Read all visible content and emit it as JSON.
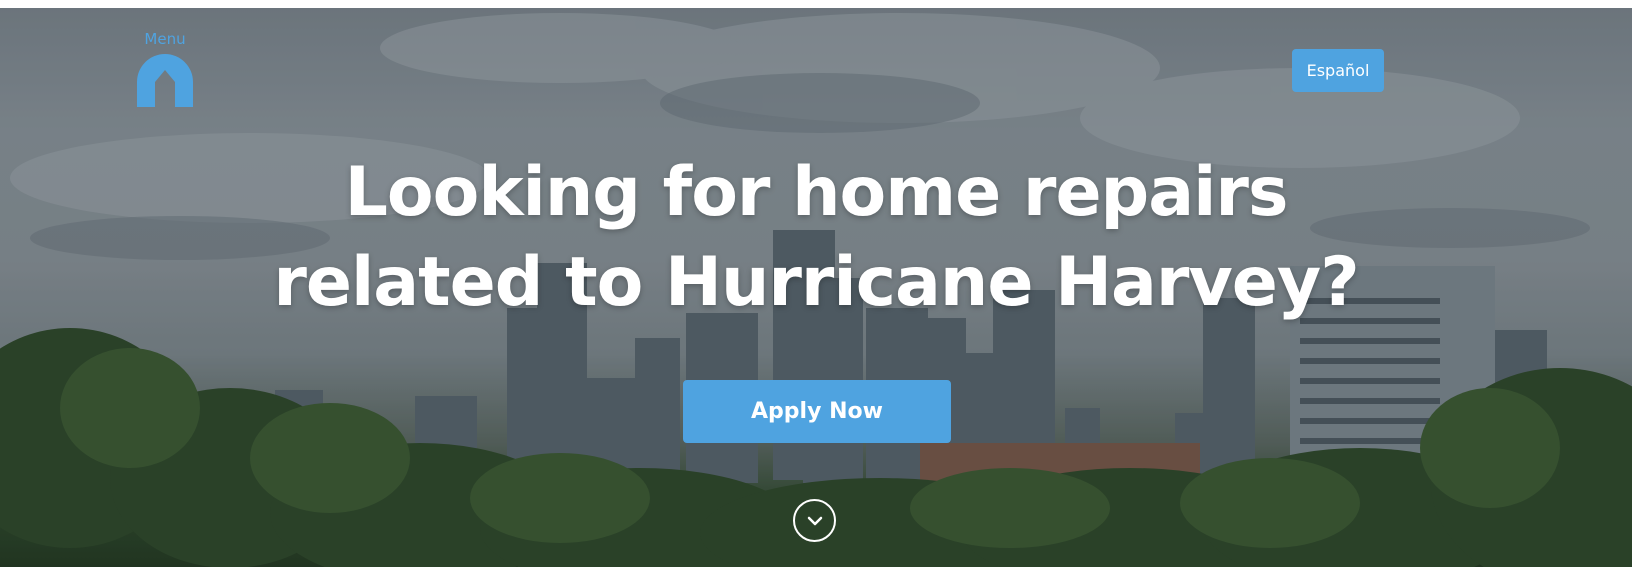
{
  "header": {
    "menu_label": "Menu",
    "menu_logo_icon": "house-arch-icon",
    "language_button_label": "Español"
  },
  "hero": {
    "headline_line1": "Looking for home repairs",
    "headline_line2": "related to Hurricane Harvey?",
    "cta_label": "Apply Now",
    "scroll_icon": "chevron-down-circle-icon"
  },
  "colors": {
    "accent": "#4fa3e0",
    "headline": "#ffffff"
  }
}
